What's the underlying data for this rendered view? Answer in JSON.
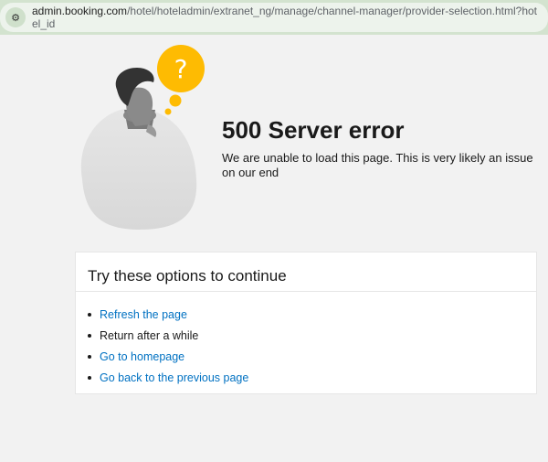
{
  "browser": {
    "url_domain": "admin.booking.com",
    "url_path": "/hotel/hoteladmin/extranet_ng/manage/channel-manager/provider-selection.html?hotel_id"
  },
  "error": {
    "title": "500 Server error",
    "message": "We are unable to load this page. This is very likely an issue on our end",
    "illustration_symbol": "?"
  },
  "options": {
    "heading": "Try these options to continue",
    "items": [
      {
        "label": "Refresh the page",
        "link": true
      },
      {
        "label": "Return after a while",
        "link": false
      },
      {
        "label": "Go to homepage",
        "link": true
      },
      {
        "label": "Go back to the previous page",
        "link": true
      }
    ]
  },
  "colors": {
    "link": "#0071c2",
    "accent": "#febb02"
  }
}
